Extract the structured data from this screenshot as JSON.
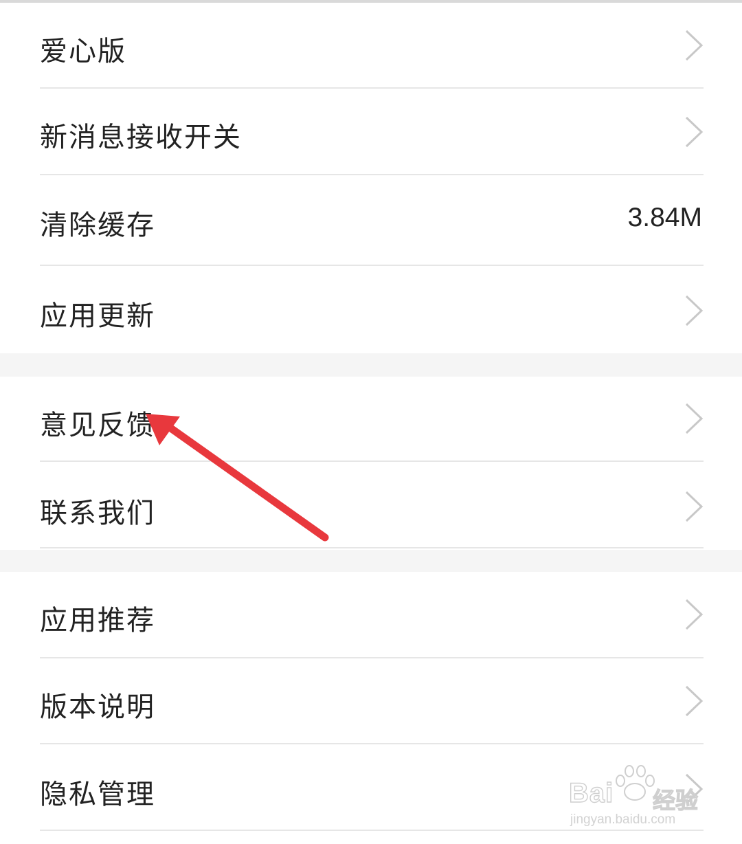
{
  "settings": {
    "love_edition": "爱心版",
    "new_message_toggle": "新消息接收开关",
    "clear_cache": "清除缓存",
    "cache_size": "3.84M",
    "app_update": "应用更新",
    "feedback": "意见反馈",
    "contact_us": "联系我们",
    "app_recommend": "应用推荐",
    "version_notes": "版本说明",
    "privacy_management": "隐私管理"
  },
  "annotation": {
    "arrow_color": "#e8383d",
    "points_to": "feedback"
  },
  "watermark": {
    "brand": "Bai",
    "brand_cn": "经验",
    "url": "jingyan.baidu.com"
  },
  "colors": {
    "background": "#f5f5f5",
    "row_bg": "#ffffff",
    "text": "#222222",
    "chevron": "#c8c8c8",
    "divider": "#e6e6e6"
  }
}
